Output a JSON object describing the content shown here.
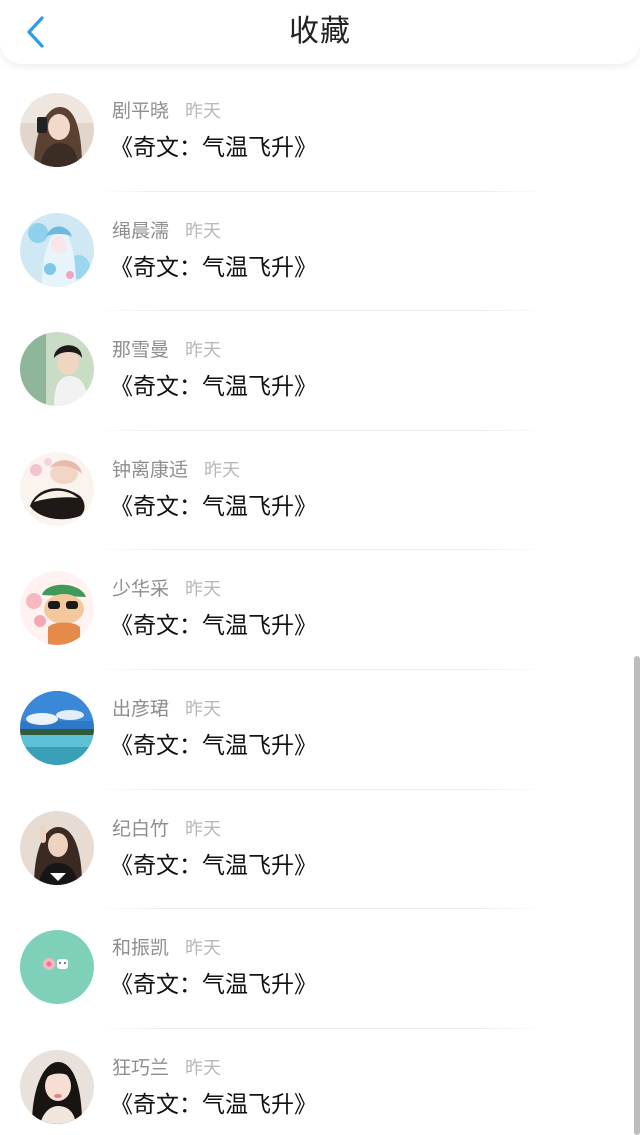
{
  "header": {
    "title": "收藏"
  },
  "favorites": [
    {
      "name": "剧平晓",
      "time": "昨天",
      "book": "《奇文：气温飞升》"
    },
    {
      "name": "绳晨濡",
      "time": "昨天",
      "book": "《奇文：气温飞升》"
    },
    {
      "name": "那雪曼",
      "time": "昨天",
      "book": "《奇文：气温飞升》"
    },
    {
      "name": "钟离康适",
      "time": "昨天",
      "book": "《奇文：气温飞升》"
    },
    {
      "name": "少华采",
      "time": "昨天",
      "book": "《奇文：气温飞升》"
    },
    {
      "name": "出彦珺",
      "time": "昨天",
      "book": "《奇文：气温飞升》"
    },
    {
      "name": "纪白竹",
      "time": "昨天",
      "book": "《奇文：气温飞升》"
    },
    {
      "name": "和振凯",
      "time": "昨天",
      "book": "《奇文：气温飞升》"
    },
    {
      "name": "狂巧兰",
      "time": "昨天",
      "book": "《奇文：气温飞升》"
    }
  ],
  "colors": {
    "accent": "#2f9be8",
    "title": "#222222",
    "name": "#8e8e8e",
    "time": "#b8b8b8"
  },
  "icons": {
    "back": "chevron-left-icon"
  }
}
